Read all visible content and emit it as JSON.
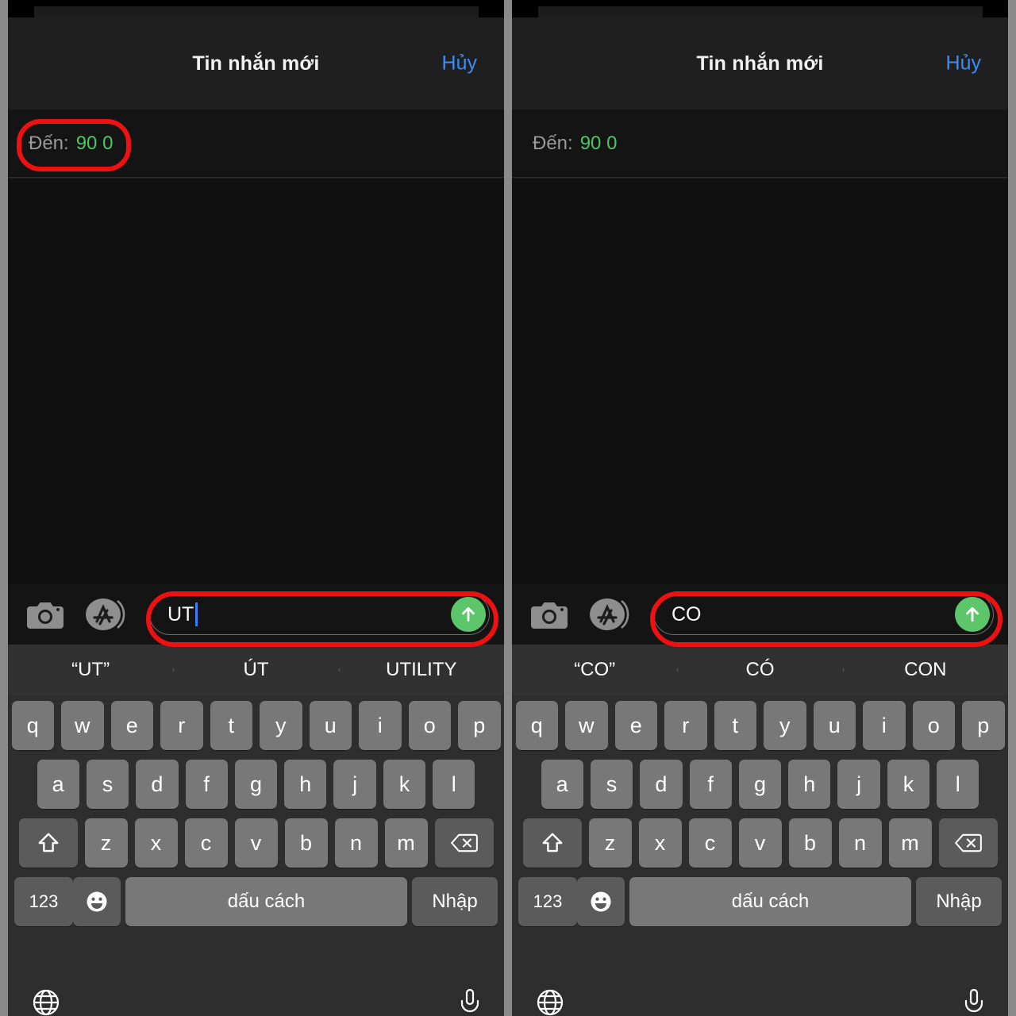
{
  "panels": [
    {
      "nav": {
        "title": "Tin nhắn mới",
        "cancel": "Hủy"
      },
      "recipient": {
        "label": "Đến:",
        "value": "90 0"
      },
      "composer": {
        "camera_icon": "camera-icon",
        "appstore_icon": "app-store-icon",
        "text": "UT",
        "has_caret": true,
        "send_icon": "arrow-up-icon"
      },
      "suggestions": [
        "“UT”",
        "ÚT",
        "UTILITY"
      ],
      "highlight_to": true,
      "highlight_msg": true
    },
    {
      "nav": {
        "title": "Tin nhắn mới",
        "cancel": "Hủy"
      },
      "recipient": {
        "label": "Đến:",
        "value": "90 0"
      },
      "composer": {
        "camera_icon": "camera-icon",
        "appstore_icon": "app-store-icon",
        "text": "CO",
        "has_caret": false,
        "send_icon": "arrow-up-icon"
      },
      "suggestions": [
        "“CO”",
        "CÓ",
        "CON"
      ],
      "highlight_to": false,
      "highlight_msg": true
    }
  ],
  "keyboard": {
    "row1": [
      "q",
      "w",
      "e",
      "r",
      "t",
      "y",
      "u",
      "i",
      "o",
      "p"
    ],
    "row2": [
      "a",
      "s",
      "d",
      "f",
      "g",
      "h",
      "j",
      "k",
      "l"
    ],
    "row3": [
      "z",
      "x",
      "c",
      "v",
      "b",
      "n",
      "m"
    ],
    "shift_icon": "shift-up-arrow-icon",
    "backspace_icon": "backspace-delete-icon",
    "numbers_key": "123",
    "emoji_icon": "emoji-smiley-icon",
    "space_key": "dấu cách",
    "enter_key": "Nhập",
    "globe_icon": "globe-language-icon",
    "mic_icon": "microphone-icon"
  },
  "colors": {
    "accent_blue": "#3b8cf5",
    "recipient_green": "#4cc764",
    "send_green": "#5dc66a",
    "highlight_red": "#ee1111",
    "caret_blue": "#3b7ef5"
  }
}
